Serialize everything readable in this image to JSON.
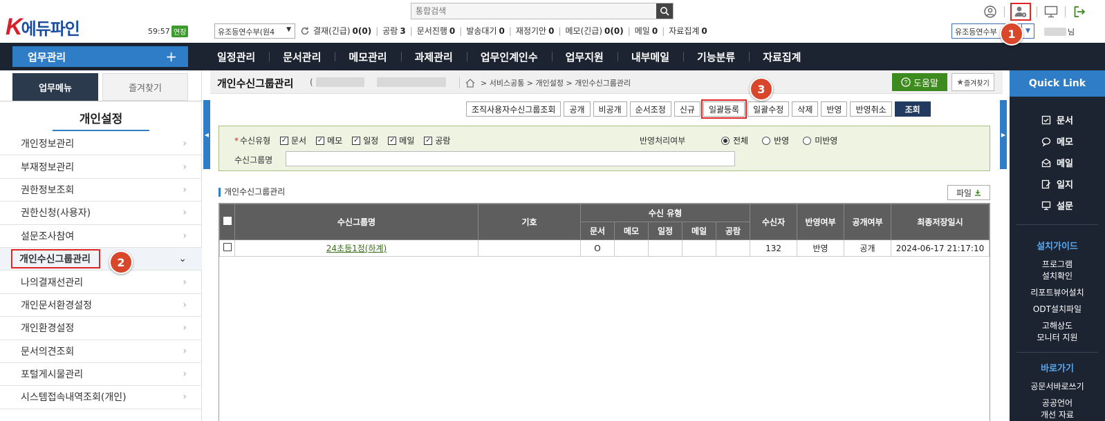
{
  "header": {
    "logo_k": "K",
    "logo_rest": "에듀파인",
    "timer": "59:57",
    "extend_label": "연장",
    "search_placeholder": "통합검색",
    "dept_select": "유조등연수부(원4",
    "counters": [
      {
        "label": "결재(긴급)",
        "value": "0(0)"
      },
      {
        "label": "공람",
        "value": "3"
      },
      {
        "label": "문서진행",
        "value": "0"
      },
      {
        "label": "발송대기",
        "value": "0"
      },
      {
        "label": "재정기안",
        "value": "0"
      },
      {
        "label": "메모(긴급)",
        "value": "0(0)"
      },
      {
        "label": "메일",
        "value": "0"
      },
      {
        "label": "자료집계",
        "value": "0"
      }
    ],
    "user_select": "유조등연수부",
    "user_suffix": "님"
  },
  "nav": {
    "work_label": "업무관리",
    "items": [
      "일정관리",
      "문서관리",
      "메모관리",
      "과제관리",
      "업무인계인수",
      "업무지원",
      "내부메일",
      "기능분류",
      "자료집계"
    ]
  },
  "sidebar": {
    "tab_active": "업무메뉴",
    "tab_inactive": "즐겨찾기",
    "title": "개인설정",
    "items": [
      "개인정보관리",
      "부재정보관리",
      "권한정보조회",
      "권한신청(사용자)",
      "설문조사참여",
      "개인수신그룹관리",
      "나의결재선관리",
      "개인문서환경설정",
      "개인환경설정",
      "문서의견조회",
      "포털게시물관리",
      "시스템접속내역조회(개인)"
    ]
  },
  "page": {
    "title": "개인수신그룹관리",
    "sub_open": "(",
    "breadcrumb": "> 서비스공통 > 개인설정 > 개인수신그룹관리",
    "help_label": "도움말",
    "fav_label": "즐겨찾기"
  },
  "toolbar": [
    "조직사용자수신그룹조회",
    "공개",
    "비공개",
    "순서조정",
    "신규",
    "일괄등록",
    "일괄수정",
    "삭제",
    "반영",
    "반영취소",
    "조회"
  ],
  "filter": {
    "type_label": "수신유형",
    "type_options": [
      "문서",
      "메모",
      "일정",
      "메일",
      "공람"
    ],
    "apply_label": "반영처리여부",
    "apply_options": [
      "전체",
      "반영",
      "미반영"
    ],
    "apply_selected": "전체",
    "group_label": "수신그룹명"
  },
  "grid": {
    "section_title": "개인수신그룹관리",
    "file_label": "파일",
    "headers": {
      "name": "수신그룹명",
      "symbol": "기호",
      "type_group": "수신 유형",
      "types": [
        "문서",
        "메모",
        "일정",
        "메일",
        "공람"
      ],
      "recipients": "수신자",
      "applied": "반영여부",
      "public": "공개여부",
      "saved": "최종저장일시"
    },
    "rows": [
      {
        "name": "24초등1정(하계)",
        "symbol": "",
        "types": [
          "O",
          "",
          "",
          "",
          ""
        ],
        "recipients": "132",
        "applied": "반영",
        "public": "공개",
        "saved": "2024-06-17 21:17:10"
      }
    ]
  },
  "quicklink": {
    "title": "Quick Link",
    "items": [
      "문서",
      "메모",
      "메일",
      "일지",
      "설문"
    ],
    "install_title": "설치가이드",
    "install_items": [
      "프로그램\n설치확인",
      "리포트뷰어설치",
      "ODT설치파일",
      "고해상도\n모니터 지원"
    ],
    "shortcut_title": "바로가기",
    "shortcut_items": [
      "공문서바로쓰기",
      "공공언어\n개선 자료"
    ]
  },
  "badges": [
    "1",
    "2",
    "3"
  ],
  "colors": {
    "accent": "#2e7dc6",
    "nav_bg": "#1c2331",
    "highlight": "#e02424",
    "badge": "#d9472b",
    "help_green": "#3d8a1e"
  }
}
